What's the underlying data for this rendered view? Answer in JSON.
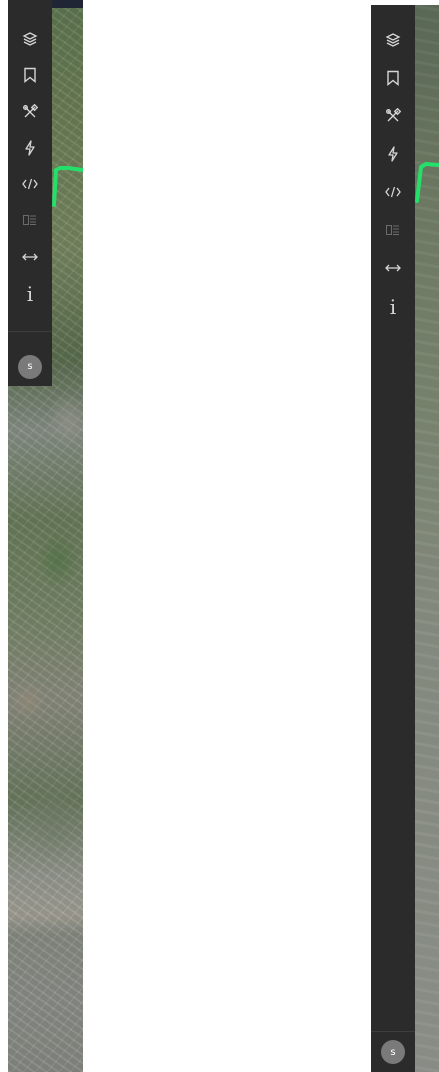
{
  "user": {
    "avatar_initial": "s"
  },
  "toolbar": {
    "items": [
      {
        "name": "layers",
        "icon": "layers-icon",
        "disabled": false
      },
      {
        "name": "bookmark",
        "icon": "bookmark-icon",
        "disabled": false
      },
      {
        "name": "tools",
        "icon": "tools-icon",
        "disabled": false
      },
      {
        "name": "flash",
        "icon": "lightning-icon",
        "disabled": false
      },
      {
        "name": "code",
        "icon": "code-icon",
        "disabled": false
      },
      {
        "name": "grid",
        "icon": "grid-icon",
        "disabled": true
      },
      {
        "name": "compare",
        "icon": "arrows-horizontal-icon",
        "disabled": false
      },
      {
        "name": "info",
        "label": "i",
        "icon": "info-icon",
        "disabled": false
      }
    ]
  },
  "route": {
    "color": "#22e06a"
  }
}
